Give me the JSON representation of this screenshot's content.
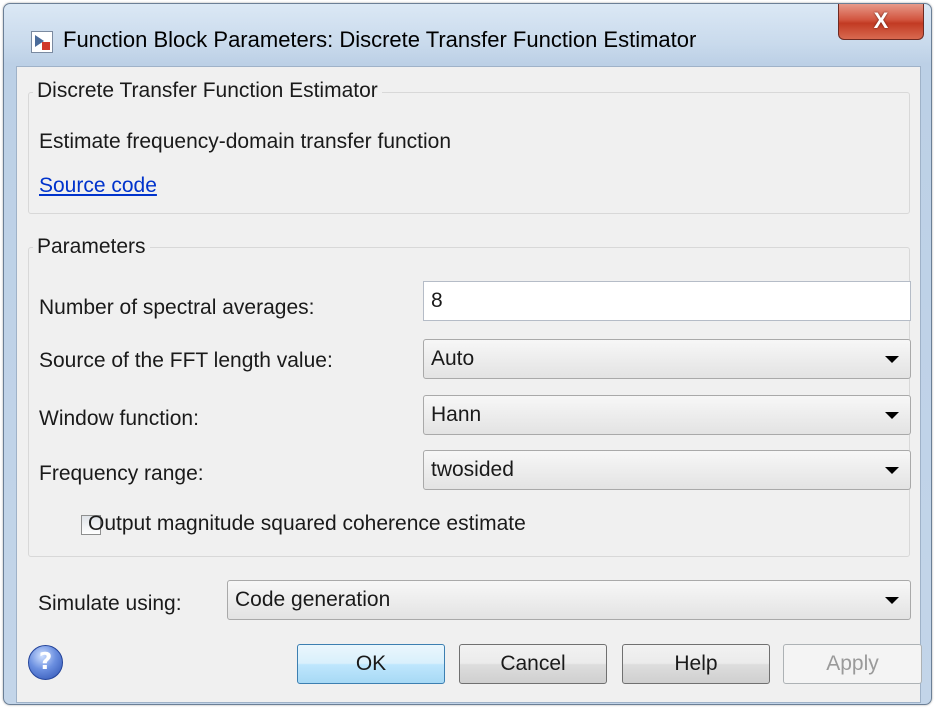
{
  "window": {
    "title": "Function Block Parameters: Discrete Transfer Function Estimator",
    "close_glyph": "X"
  },
  "block": {
    "group_title": "Discrete Transfer Function Estimator",
    "description": "Estimate frequency-domain transfer function",
    "source_link": "Source code"
  },
  "parameters": {
    "group_title": "Parameters",
    "spectral_averages": {
      "label": "Number of spectral averages:",
      "value": "8"
    },
    "fft_source": {
      "label": "Source of the FFT length value:",
      "value": "Auto"
    },
    "window_function": {
      "label": "Window function:",
      "value": "Hann"
    },
    "frequency_range": {
      "label": "Frequency range:",
      "value": "twosided"
    },
    "coherence": {
      "label": "Output magnitude squared coherence estimate",
      "checked": false
    }
  },
  "simulate": {
    "label": "Simulate using:",
    "value": "Code generation"
  },
  "buttons": {
    "help_glyph": "?",
    "ok": "OK",
    "cancel": "Cancel",
    "help": "Help",
    "apply": "Apply"
  }
}
